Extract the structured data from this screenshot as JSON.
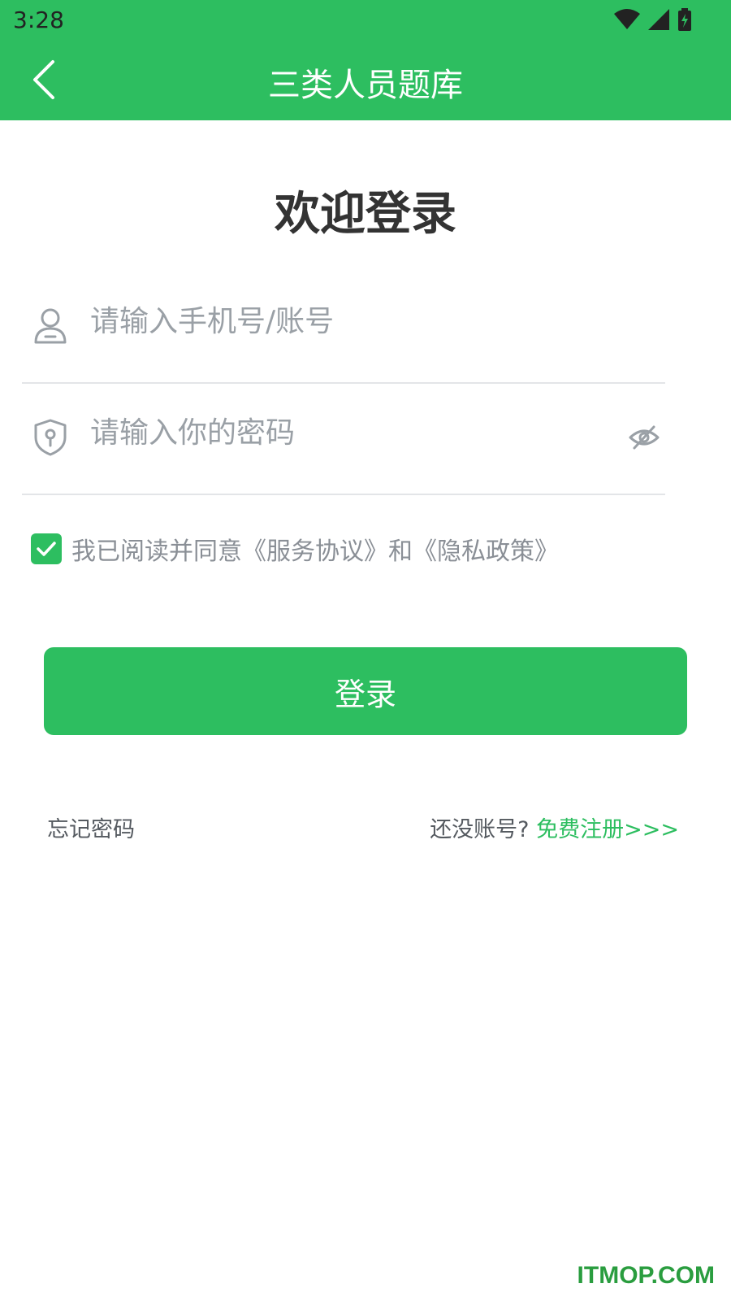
{
  "status_bar": {
    "time": "3:28",
    "icons": [
      "wifi-icon",
      "cellular-signal-icon",
      "battery-charging-icon"
    ]
  },
  "app_bar": {
    "back_icon": "chevron-left-icon",
    "title": "三类人员题库"
  },
  "welcome_title": "欢迎登录",
  "form": {
    "phone_placeholder": "请输入手机号/账号",
    "phone_value": "",
    "phone_icon": "user-icon",
    "password_placeholder": "请输入你的密码",
    "password_value": "",
    "password_icon": "shield-key-icon",
    "eye_icon": "eye-off-icon",
    "agree_checked": true,
    "agree_text": "我已阅读并同意《服务协议》和《隐私政策》"
  },
  "login_button": "登录",
  "links": {
    "forgot": "忘记密码",
    "no_account": "还没账号?",
    "register": "免费注册>>>"
  },
  "watermark": "ITMOP.COM",
  "colors": {
    "primary": "#2dbe60",
    "text_dark": "#333333",
    "text_gray": "#8a8f96",
    "placeholder": "#9aa0a6",
    "divider": "#e3e5e8"
  }
}
